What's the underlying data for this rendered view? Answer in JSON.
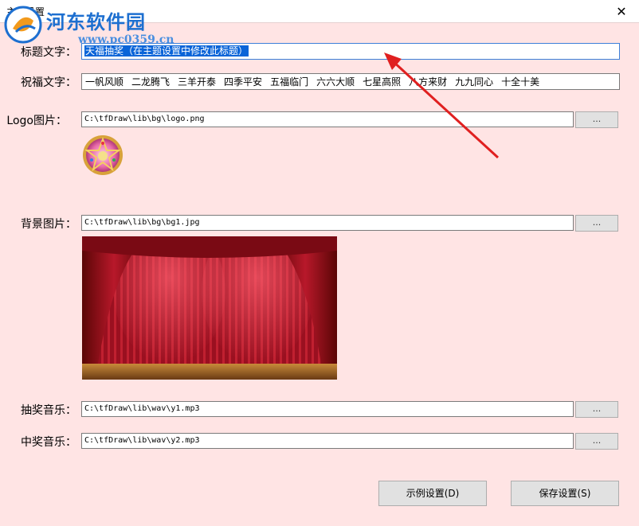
{
  "window": {
    "title": "主题设置",
    "close_glyph": "✕"
  },
  "watermark": {
    "name": "河东软件园",
    "url": "www.pc0359.cn"
  },
  "fields": {
    "title_label": "标题文字：",
    "title_value": "天福抽奖（在主题设置中修改此标题）",
    "blessing_label": "祝福文字：",
    "blessings": [
      "一帆风顺",
      "二龙腾飞",
      "三羊开泰",
      "四季平安",
      "五福临门",
      "六六大顺",
      "七星高照",
      "八方来财",
      "九九同心",
      "十全十美"
    ],
    "logo_label": "Logo图片：",
    "logo_path": "C:\\tfDraw\\lib\\bg\\logo.png",
    "bg_label": "背景图片：",
    "bg_path": "C:\\tfDraw\\lib\\bg\\bg1.jpg",
    "draw_music_label": "抽奖音乐：",
    "draw_music_path": "C:\\tfDraw\\lib\\wav\\y1.mp3",
    "win_music_label": "中奖音乐：",
    "win_music_path": "C:\\tfDraw\\lib\\wav\\y2.mp3",
    "browse_label": "..."
  },
  "buttons": {
    "example": "示例设置(D)",
    "save": "保存设置(S)"
  },
  "colors": {
    "background": "#ffe4e4",
    "selection": "#0a64d8",
    "arrow": "#e02020",
    "watermark": "#1d6fd0"
  }
}
